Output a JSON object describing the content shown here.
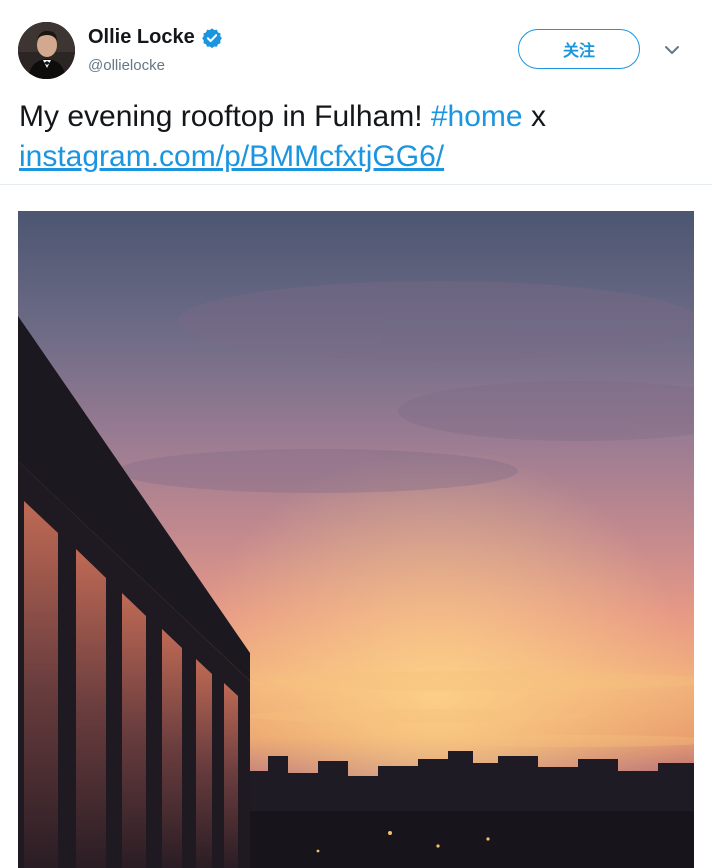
{
  "tweet": {
    "author": {
      "display_name": "Ollie Locke",
      "handle": "@ollielocke",
      "verified": true,
      "avatar_icon": "avatar-photo"
    },
    "follow_label": "关注",
    "text": {
      "before": "My evening rooftop in Fulham! ",
      "hashtag": "#home",
      "after": " x",
      "link": "instagram.com/p/BMMcfxtjGG6/"
    },
    "media": {
      "icon": "sunset-rooftop-photo"
    }
  },
  "colors": {
    "accent": "#1b95e0",
    "text": "#14171a",
    "muted": "#657786",
    "divider": "#e6ecf0"
  }
}
